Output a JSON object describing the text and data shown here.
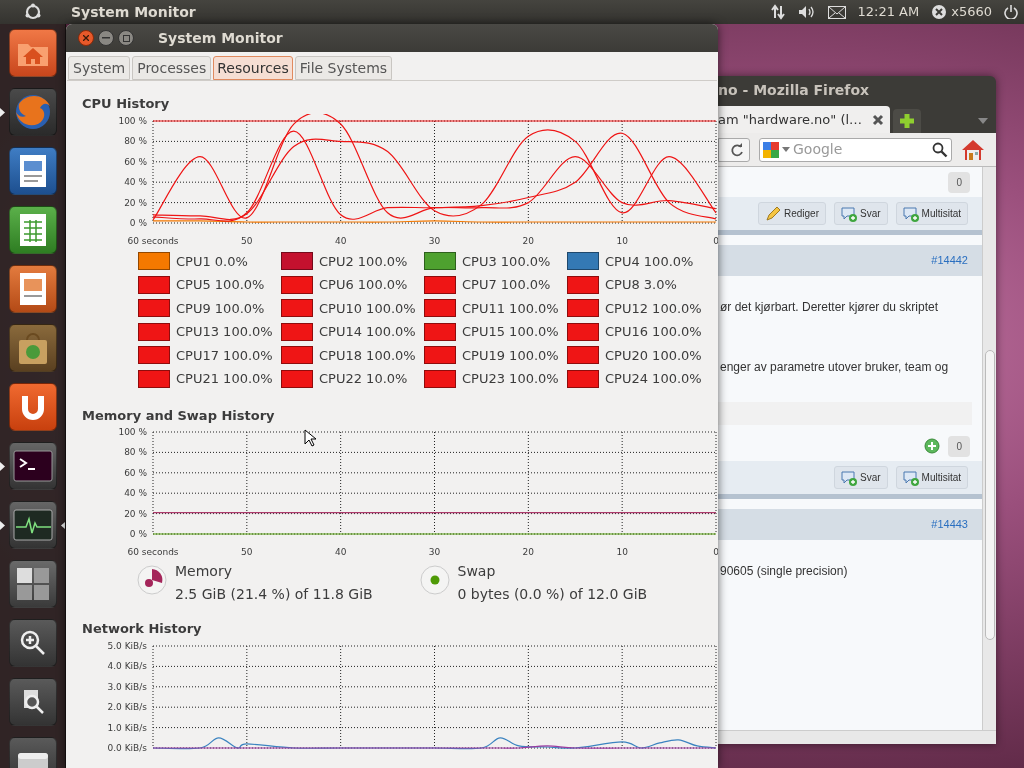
{
  "top_panel": {
    "app_title": "System Monitor",
    "clock": "12:21 AM",
    "user": "x5660"
  },
  "launcher": {
    "items": [
      {
        "kind": "folder",
        "running": false,
        "active": false
      },
      {
        "kind": "browser",
        "running": true,
        "active": false
      },
      {
        "kind": "document",
        "running": false,
        "active": false
      },
      {
        "kind": "spreadsheet",
        "running": false,
        "active": false
      },
      {
        "kind": "presentation",
        "running": false,
        "active": false
      },
      {
        "kind": "software",
        "running": false,
        "active": false
      },
      {
        "kind": "cloud",
        "running": false,
        "active": false
      },
      {
        "kind": "terminal",
        "running": true,
        "active": false
      },
      {
        "kind": "monitor",
        "running": true,
        "active": true
      },
      {
        "kind": "workspaces",
        "running": false,
        "active": false
      },
      {
        "kind": "zoom",
        "running": false,
        "active": false
      },
      {
        "kind": "file-search",
        "running": false,
        "active": false
      },
      {
        "kind": "drive",
        "running": false,
        "active": false
      }
    ]
  },
  "window": {
    "title": "System Monitor",
    "tabs": [
      {
        "label": "System",
        "selected": false
      },
      {
        "label": "Processes",
        "selected": false
      },
      {
        "label": "Resources",
        "selected": true
      },
      {
        "label": "File Systems",
        "selected": false
      }
    ]
  },
  "cpu": {
    "title": "CPU History",
    "chart_data": {
      "type": "line",
      "grid": true,
      "x": [
        60,
        55,
        50,
        45,
        40,
        35,
        30,
        25,
        20,
        15,
        10,
        5,
        0
      ],
      "xlim": [
        60,
        0
      ],
      "ylim": [
        0,
        100
      ],
      "xticks": [
        {
          "value": 60,
          "label": "60 seconds"
        },
        50,
        40,
        30,
        20,
        10,
        0
      ],
      "yticks": [
        {
          "value": 100,
          "label": "100 %"
        },
        {
          "value": 80,
          "label": "80 %"
        },
        {
          "value": 60,
          "label": "60 %"
        },
        {
          "value": 40,
          "label": "40 %"
        },
        {
          "value": 20,
          "label": "20 %"
        },
        {
          "value": 0,
          "label": "0 %"
        }
      ],
      "series": [
        {
          "color": "#ef1515",
          "values": [
            100,
            100,
            100,
            100,
            100,
            100,
            100,
            100,
            100,
            100,
            100,
            100,
            100
          ]
        },
        {
          "color": "#f57900",
          "values": [
            2,
            2,
            1,
            1,
            1,
            1,
            2,
            1,
            1,
            1,
            1,
            1,
            1
          ]
        },
        {
          "color": "#ef1515",
          "values": [
            3,
            65,
            5,
            97,
            97,
            10,
            15,
            15,
            20,
            65,
            20,
            22,
            14
          ]
        },
        {
          "color": "#ef1515",
          "values": [
            6,
            4,
            10,
            90,
            8,
            15,
            15,
            17,
            25,
            40,
            88,
            20,
            4
          ]
        },
        {
          "color": "#ef1515",
          "values": [
            8,
            7,
            9,
            75,
            80,
            70,
            12,
            18,
            85,
            80,
            10,
            65,
            10
          ]
        }
      ]
    },
    "legend": [
      {
        "label": "CPU1 0.0%",
        "color": "#f57900"
      },
      {
        "label": "CPU2 100.0%",
        "color": "#c4112e"
      },
      {
        "label": "CPU3 100.0%",
        "color": "#4ea12f"
      },
      {
        "label": "CPU4 100.0%",
        "color": "#3479b4"
      },
      {
        "label": "CPU5 100.0%",
        "color": "#ef1515"
      },
      {
        "label": "CPU6 100.0%",
        "color": "#ef1515"
      },
      {
        "label": "CPU7 100.0%",
        "color": "#ef1515"
      },
      {
        "label": "CPU8 3.0%",
        "color": "#ef1515"
      },
      {
        "label": "CPU9 100.0%",
        "color": "#ef1515"
      },
      {
        "label": "CPU10 100.0%",
        "color": "#ef1515"
      },
      {
        "label": "CPU11 100.0%",
        "color": "#ef1515"
      },
      {
        "label": "CPU12 100.0%",
        "color": "#ef1515"
      },
      {
        "label": "CPU13 100.0%",
        "color": "#ef1515"
      },
      {
        "label": "CPU14 100.0%",
        "color": "#ef1515"
      },
      {
        "label": "CPU15 100.0%",
        "color": "#ef1515"
      },
      {
        "label": "CPU16 100.0%",
        "color": "#ef1515"
      },
      {
        "label": "CPU17 100.0%",
        "color": "#ef1515"
      },
      {
        "label": "CPU18 100.0%",
        "color": "#ef1515"
      },
      {
        "label": "CPU19 100.0%",
        "color": "#ef1515"
      },
      {
        "label": "CPU20 100.0%",
        "color": "#ef1515"
      },
      {
        "label": "CPU21 100.0%",
        "color": "#ef1515"
      },
      {
        "label": "CPU22 10.0%",
        "color": "#ef1515"
      },
      {
        "label": "CPU23 100.0%",
        "color": "#ef1515"
      },
      {
        "label": "CPU24 100.0%",
        "color": "#ef1515"
      }
    ]
  },
  "memory": {
    "title": "Memory and Swap History",
    "chart_data": {
      "type": "line",
      "grid": true,
      "x": [
        60,
        0
      ],
      "xlim": [
        60,
        0
      ],
      "ylim": [
        0,
        100
      ],
      "xticks": [
        {
          "value": 60,
          "label": "60 seconds"
        },
        50,
        40,
        30,
        20,
        10,
        0
      ],
      "yticks": [
        {
          "value": 100,
          "label": "100 %"
        },
        {
          "value": 80,
          "label": "80 %"
        },
        {
          "value": 60,
          "label": "60 %"
        },
        {
          "value": 40,
          "label": "40 %"
        },
        {
          "value": 20,
          "label": "20 %"
        },
        {
          "value": 0,
          "label": "0 %"
        }
      ],
      "series": [
        {
          "color": "#ad3b6b",
          "values": [
            21,
            21
          ]
        },
        {
          "color": "#4e9a06",
          "values": [
            0,
            0
          ]
        }
      ]
    },
    "legend": [
      {
        "kind": "pie",
        "label": "Memory",
        "detail": "2.5 GiB (21.4 %) of 11.8 GiB",
        "color": "#a4265a"
      },
      {
        "kind": "dot",
        "label": "Swap",
        "detail": "0 bytes (0.0 %) of 12.0 GiB",
        "color": "#4e9a06"
      }
    ]
  },
  "network": {
    "title": "Network History",
    "chart_data": {
      "type": "line",
      "grid": true,
      "x": [
        60,
        55,
        53,
        51,
        50,
        45,
        40,
        35,
        30,
        25,
        23,
        21,
        18,
        15,
        10,
        8,
        6,
        4,
        2,
        0
      ],
      "xlim": [
        60,
        0
      ],
      "ylim": [
        0,
        5
      ],
      "yticks": [
        {
          "value": 5,
          "label": "5.0 KiB/s"
        },
        {
          "value": 4,
          "label": "4.0 KiB/s"
        },
        {
          "value": 3,
          "label": "3.0 KiB/s"
        },
        {
          "value": 2,
          "label": "2.0 KiB/s"
        },
        {
          "value": 1,
          "label": "1.0 KiB/s"
        },
        {
          "value": 0,
          "label": "0.0 KiB/s"
        }
      ],
      "series": [
        {
          "color": "#3b83c0",
          "values": [
            0,
            0,
            0.5,
            0,
            0.2,
            0,
            0,
            0,
            0,
            0,
            0.5,
            0.1,
            0.05,
            0,
            0.3,
            0,
            0.25,
            0.4,
            0.1,
            0
          ]
        },
        {
          "color": "#9c3ba0",
          "values": [
            0,
            0,
            0,
            0,
            0,
            0,
            0,
            0,
            0,
            0,
            0,
            0,
            0.1,
            0,
            0,
            0,
            0,
            0,
            0,
            0
          ]
        }
      ]
    }
  },
  "firefox": {
    "title": "no - Mozilla Firefox",
    "tab": "am \"hardware.no\" (l…",
    "search": {
      "placeholder": "Google"
    },
    "blocks": [
      {
        "kind": "counter",
        "value": "0",
        "plus": false
      },
      {
        "kind": "actions",
        "buttons": [
          {
            "label": "Rediger",
            "kind": "edit"
          },
          {
            "label": "Svar",
            "kind": "reply"
          },
          {
            "label": "Multisitat",
            "kind": "reply"
          }
        ]
      },
      {
        "kind": "header",
        "number": "#14442"
      },
      {
        "kind": "text",
        "text": "ør det kjørbart. Deretter kjører du skriptet"
      },
      {
        "kind": "text",
        "text": "enger av parametre utover bruker, team og"
      },
      {
        "kind": "quote"
      },
      {
        "kind": "counter",
        "value": "0",
        "plus": true
      },
      {
        "kind": "actions",
        "buttons": [
          {
            "label": "Svar",
            "kind": "reply"
          },
          {
            "label": "Multisitat",
            "kind": "reply"
          }
        ]
      },
      {
        "kind": "header",
        "number": "#14443"
      },
      {
        "kind": "text",
        "text": "90605 (single precision)"
      }
    ]
  }
}
